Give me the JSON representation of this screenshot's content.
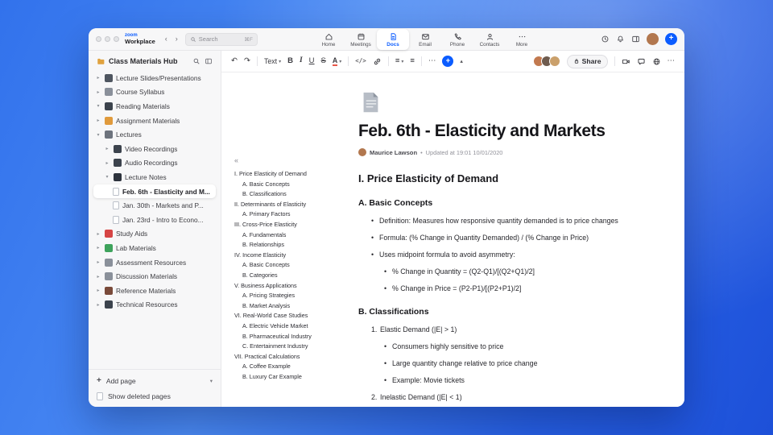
{
  "topbar": {
    "brand_top": "zoom",
    "brand_bottom": "Workplace",
    "search": {
      "placeholder": "Search",
      "shortcut": "⌘F"
    },
    "tabs": [
      {
        "id": "home",
        "label": "Home",
        "active": false
      },
      {
        "id": "meetings",
        "label": "Meetings",
        "active": false
      },
      {
        "id": "docs",
        "label": "Docs",
        "active": true
      },
      {
        "id": "email",
        "label": "Email",
        "active": false
      },
      {
        "id": "phone",
        "label": "Phone",
        "active": false
      },
      {
        "id": "contacts",
        "label": "Contacts",
        "active": false
      },
      {
        "id": "more",
        "label": "More",
        "active": false
      }
    ]
  },
  "sidebar": {
    "title": "Class Materials Hub",
    "tree": [
      {
        "label": "Lecture Slides/Presentations",
        "depth": 0,
        "icon": "slides",
        "chevron": "closed"
      },
      {
        "label": "Course Syllabus",
        "depth": 0,
        "icon": "syllabus",
        "chevron": "closed"
      },
      {
        "label": "Reading Materials",
        "depth": 0,
        "icon": "reading",
        "chevron": "open"
      },
      {
        "label": "Assignment Materials",
        "depth": 0,
        "icon": "assignment",
        "chevron": "closed"
      },
      {
        "label": "Lectures",
        "depth": 0,
        "icon": "lectures",
        "chevron": "open"
      },
      {
        "label": "Video Recordings",
        "depth": 1,
        "icon": "video",
        "chevron": "closed"
      },
      {
        "label": "Audio Recordings",
        "depth": 1,
        "icon": "audio",
        "chevron": "closed"
      },
      {
        "label": "Lecture Notes",
        "depth": 1,
        "icon": "notes",
        "chevron": "open"
      },
      {
        "label": "Feb. 6th - Elasticity and M...",
        "depth": 2,
        "icon": "page",
        "selected": true
      },
      {
        "label": "Jan. 30th - Markets and P...",
        "depth": 2,
        "icon": "page"
      },
      {
        "label": "Jan. 23rd - Intro to Econo...",
        "depth": 2,
        "icon": "page"
      },
      {
        "label": "Study Aids",
        "depth": 0,
        "icon": "study",
        "chevron": "closed"
      },
      {
        "label": "Lab Materials",
        "depth": 0,
        "icon": "lab",
        "chevron": "closed"
      },
      {
        "label": "Assessment Resources",
        "depth": 0,
        "icon": "assessment",
        "chevron": "closed"
      },
      {
        "label": "Discussion Materials",
        "depth": 0,
        "icon": "discussion",
        "chevron": "closed"
      },
      {
        "label": "Reference Materials",
        "depth": 0,
        "icon": "reference",
        "chevron": "closed"
      },
      {
        "label": "Technical Resources",
        "depth": 0,
        "icon": "technical",
        "chevron": "closed"
      }
    ],
    "add_page": "Add page",
    "show_deleted": "Show deleted pages"
  },
  "toolbar": {
    "text_style": "Text",
    "share_label": "Share",
    "collaborators": [
      "#c2794f",
      "#6e5b4e",
      "#caa06b"
    ]
  },
  "doc": {
    "title": "Feb. 6th - Elasticity and Markets",
    "author": "Maurice Lawson",
    "updated": "Updated at 19:01 10/01/2020",
    "toc": [
      {
        "label": "I. Price Elasticity of Demand",
        "depth": 0
      },
      {
        "label": "A. Basic Concepts",
        "depth": 1
      },
      {
        "label": "B. Classifications",
        "depth": 1
      },
      {
        "label": "II. Determinants of Elasticity",
        "depth": 0
      },
      {
        "label": "A. Primary Factors",
        "depth": 1
      },
      {
        "label": "III. Cross-Price Elasticity",
        "depth": 0
      },
      {
        "label": "A. Fundamentals",
        "depth": 1
      },
      {
        "label": "B. Relationships",
        "depth": 1
      },
      {
        "label": "IV. Income Elasticity",
        "depth": 0
      },
      {
        "label": "A. Basic Concepts",
        "depth": 1
      },
      {
        "label": "B. Categories",
        "depth": 1
      },
      {
        "label": "V. Business Applications",
        "depth": 0
      },
      {
        "label": "A. Pricing Strategies",
        "depth": 1
      },
      {
        "label": "B. Market Analysis",
        "depth": 1
      },
      {
        "label": "VI. Real-World Case Studies",
        "depth": 0
      },
      {
        "label": "A. Electric Vehicle Market",
        "depth": 1
      },
      {
        "label": "B. Pharmaceutical Industry",
        "depth": 1
      },
      {
        "label": "C. Entertainment Industry",
        "depth": 1
      },
      {
        "label": "VII. Practical Calculations",
        "depth": 0
      },
      {
        "label": "A. Coffee Example",
        "depth": 1
      },
      {
        "label": "B. Luxury Car Example",
        "depth": 1
      }
    ],
    "blocks": [
      {
        "type": "h2",
        "text": "I. Price Elasticity of Demand"
      },
      {
        "type": "h3",
        "text": "A. Basic Concepts"
      },
      {
        "type": "bullet",
        "depth": 0,
        "text": "Definition: Measures how responsive quantity demanded is to price changes"
      },
      {
        "type": "bullet",
        "depth": 0,
        "text": "Formula: (% Change in Quantity Demanded) / (% Change in Price)"
      },
      {
        "type": "bullet",
        "depth": 0,
        "text": "Uses midpoint formula to avoid asymmetry:"
      },
      {
        "type": "bullet",
        "depth": 1,
        "text": "% Change in Quantity = (Q2-Q1)/[(Q2+Q1)/2]"
      },
      {
        "type": "bullet",
        "depth": 1,
        "text": "% Change in Price = (P2-P1)/[(P2+P1)/2]"
      },
      {
        "type": "h3",
        "text": "B. Classifications"
      },
      {
        "type": "number",
        "num": "1.",
        "depth": 0,
        "text": "Elastic Demand (|E| > 1)"
      },
      {
        "type": "bullet",
        "depth": 1,
        "text": "Consumers highly sensitive to price"
      },
      {
        "type": "bullet",
        "depth": 1,
        "text": "Large quantity change relative to price change"
      },
      {
        "type": "bullet",
        "depth": 1,
        "text": "Example: Movie tickets"
      },
      {
        "type": "number",
        "num": "2.",
        "depth": 0,
        "text": "Inelastic Demand (|E| < 1)"
      }
    ]
  },
  "glyphs": {
    "undo": "↶",
    "redo": "↷",
    "dropdown": "▾",
    "collapse_up": "▴",
    "more": "⋯",
    "back": "‹",
    "forward": "›",
    "toc_collapse": "«",
    "bold": "B",
    "italic": "I",
    "underline": "U",
    "strike": "S",
    "color_a": "A",
    "code": "</>",
    "plus": "+",
    "list": "≡",
    "align": "≡",
    "dot": "•"
  },
  "colors": {
    "accent_blue": "#0b5cff"
  }
}
